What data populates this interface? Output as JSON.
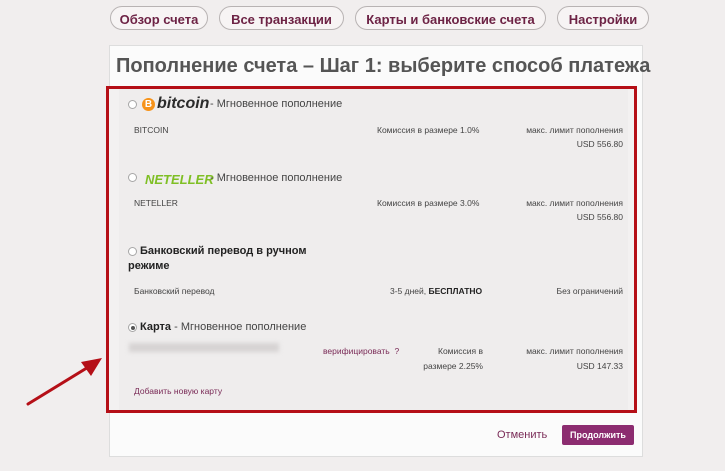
{
  "tabs": [
    {
      "label": "Обзор счета"
    },
    {
      "label": "Все транзакции"
    },
    {
      "label": "Карты и банковские счета"
    },
    {
      "label": "Настройки"
    }
  ],
  "page_title": "Пополнение счета – Шаг 1: выберите способ платежа",
  "methods": [
    {
      "logo_text": "bitcoin",
      "logo_icon": "bitcoin-icon",
      "suffix": " - Мгновенное пополнение",
      "code": "BITCOIN",
      "fee": "Комиссия в размере 1.0%",
      "limit_label": "макс. лимит пополнения",
      "limit_value": "USD 556.80"
    },
    {
      "logo_text": "NETELLER",
      "suffix": " - Мгновенное пополнение",
      "code": "NETELLER",
      "fee": "Комиссия в размере 3.0%",
      "limit_label": "макс. лимит пополнения",
      "limit_value": "USD 556.80"
    },
    {
      "title_line1": "Банковский перевод в ручном",
      "title_line2": "режиме",
      "code": "Банковский перевод",
      "fee_prefix": "3-5 дней, ",
      "fee_bold": "БЕСПЛАТНО",
      "limit_value": "Без ограничений"
    },
    {
      "title": "Карта",
      "suffix": " - Мгновенное пополнение",
      "verify": "верифицировать",
      "verify_q": "?",
      "fee_line1": "Комиссия в",
      "fee_line2": "размере 2.25%",
      "limit_label": "макс. лимит пополнения",
      "limit_value": "USD 147.33",
      "add_card": "Добавить новую карту"
    }
  ],
  "actions": {
    "cancel": "Отменить",
    "continue": "Продолжить"
  },
  "colors": {
    "accent": "#8c2c70",
    "highlight_border": "#b50f17"
  }
}
